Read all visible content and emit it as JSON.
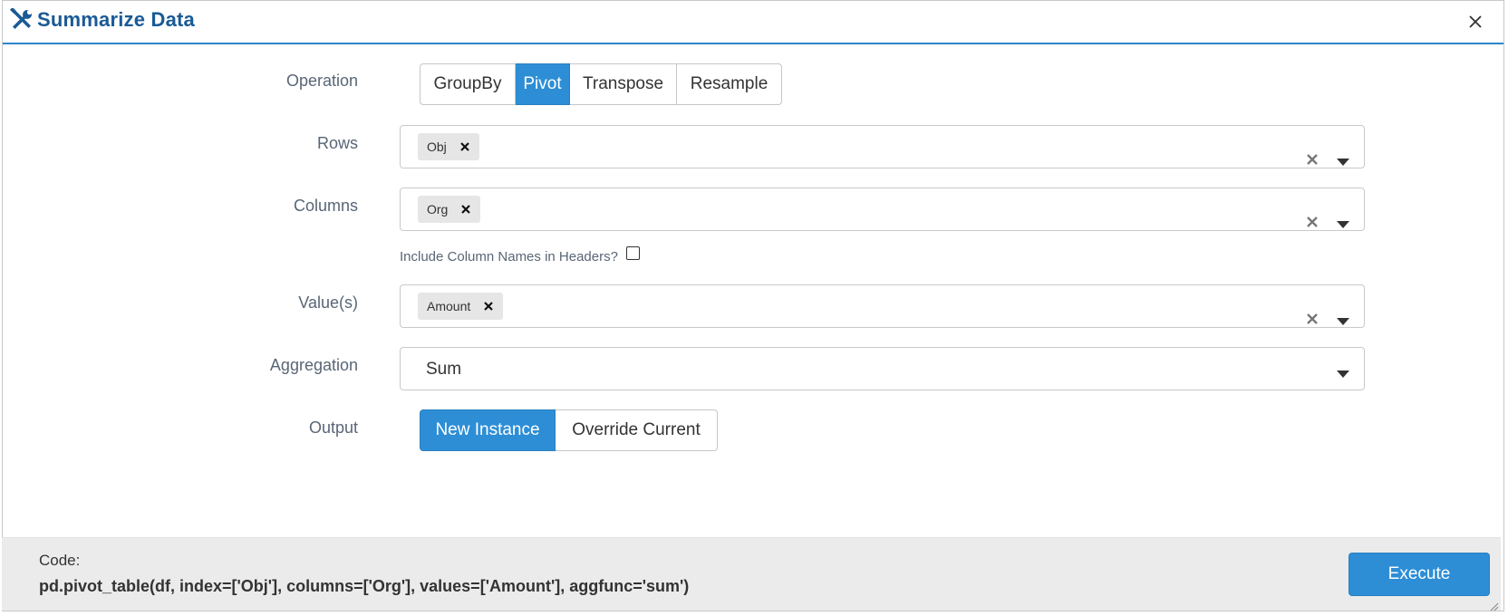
{
  "modal": {
    "title": "Summarize Data",
    "accent": "#2d8ed6"
  },
  "form": {
    "operation": {
      "label": "Operation",
      "options": [
        "GroupBy",
        "Pivot",
        "Transpose",
        "Resample"
      ],
      "selected": "Pivot"
    },
    "rows": {
      "label": "Rows",
      "tags": [
        "Obj"
      ]
    },
    "columns": {
      "label": "Columns",
      "tags": [
        "Org"
      ],
      "include_names_label": "Include Column Names in Headers?",
      "include_names_checked": false
    },
    "values": {
      "label": "Value(s)",
      "tags": [
        "Amount"
      ]
    },
    "aggregation": {
      "label": "Aggregation",
      "value": "Sum"
    },
    "output": {
      "label": "Output",
      "options": [
        "New Instance",
        "Override Current"
      ],
      "selected": "New Instance"
    }
  },
  "footer": {
    "code_label": "Code:",
    "code": "pd.pivot_table(df, index=['Obj'], columns=['Org'], values=['Amount'], aggfunc='sum')",
    "execute_label": "Execute"
  }
}
